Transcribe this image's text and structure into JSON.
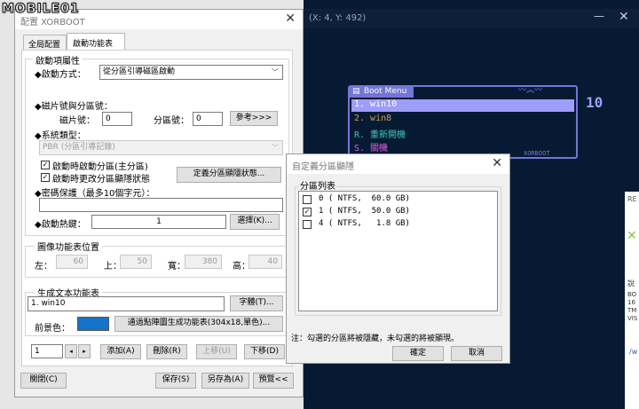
{
  "brand": "MOBILE01",
  "main_window": {
    "title": "配置 XORBOOT",
    "tabs": [
      "全局配置",
      "啟動功能表"
    ],
    "boot_group": {
      "title": "啟動項屬性",
      "method_label": "◆啟動方式：",
      "method_value": "從分區引導磁區啟動",
      "disk_part_label": "◆磁片號與分區號：",
      "disk_label": "磁片號：",
      "disk_value": "0",
      "part_label": "分區號：",
      "part_value": "0",
      "ref_button": "參考>>>",
      "systype_label": "◆系統類型：",
      "systype_value": "PBR (分區引導記錄)",
      "check1_label": "啟動時啟動分區(主分區)",
      "check2_label": "啟動時更改分區顯隱狀態",
      "define_button": "定義分區顯隱狀態...",
      "password_label": "◆密碼保護（最多10個字元）：",
      "hotkey_label": "◆啟動熱鍵：",
      "hotkey_value": "1",
      "select_button": "選擇(K)..."
    },
    "image_group": {
      "title": "圖像功能表位置",
      "left_label": "左：",
      "left_value": "60",
      "top_label": "上：",
      "top_value": "50",
      "width_label": "寬：",
      "width_value": "380",
      "height_label": "高：",
      "height_value": "40"
    },
    "text_group": {
      "title": "生成文本功能表",
      "text_value": "1. win10",
      "font_button": "字體(T)...",
      "fg_label": "前景色：",
      "gen_button": "通過點陣圖生成功能表(304x18,單色)..."
    },
    "bottom": {
      "index_value": "1",
      "add_button": "添加(A)",
      "delete_button": "刪除(R)",
      "up_button": "上移(U)",
      "down_button": "下移(D)",
      "close_button": "關閉(C)",
      "save_button": "保存(S)",
      "saveas_button": "另存為(A)",
      "preview_button": "預覽<<"
    }
  },
  "preview": {
    "coord_text": "(X: 4, Y: 492)",
    "menu_title": "Boot Menu",
    "items": [
      "1. win10",
      "2. win8",
      "R. 重新開機",
      "S. 關機"
    ],
    "countdown": "10",
    "footer_text": "XORBOOT"
  },
  "partition_dialog": {
    "title": "自定義分區顯隱",
    "group_title": "分區列表",
    "rows": [
      {
        "text": "0 ( NTFS,  60.0 GB)",
        "checked": false
      },
      {
        "text": "1 ( NTFS,  50.0 GB)",
        "checked": true
      },
      {
        "text": "4 ( NTFS,   1.8 GB)",
        "checked": false
      }
    ],
    "note": "注：勾選的分區將被隱藏，未勾選的將被顯現。",
    "ok_button": "確定",
    "cancel_button": "取消"
  },
  "colors": {
    "preview_bg": "#071a33",
    "menu_highlight": "#9d9dfa",
    "menu_purple": "#7575d8",
    "item2": "#c8a050",
    "item3": "#3cc8b4",
    "item4": "#e060e0",
    "swatch": "#1573c8"
  }
}
